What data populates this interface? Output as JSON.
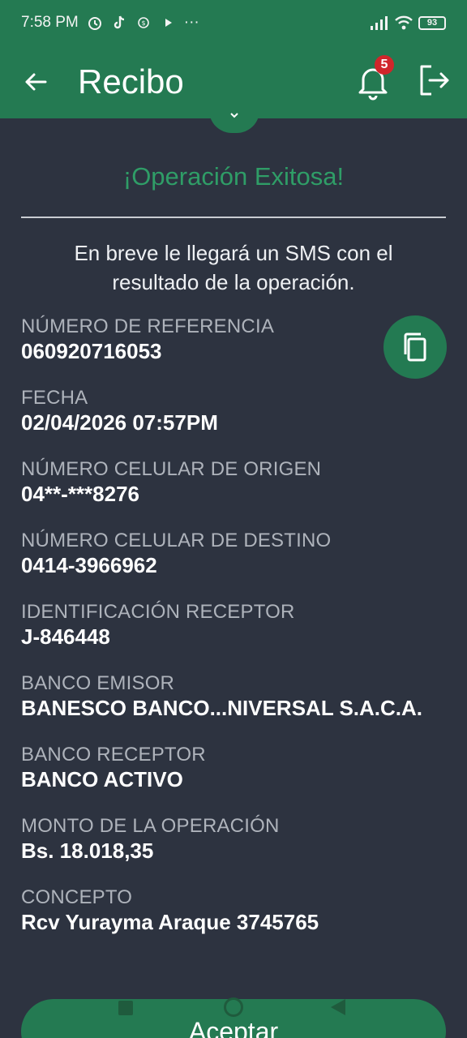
{
  "status_bar": {
    "time": "7:58 PM",
    "notification_icons": [
      "alarm-icon",
      "tiktok-icon",
      "app-icon",
      "play-icon"
    ],
    "more": "···",
    "battery": "93"
  },
  "app_bar": {
    "title": "Recibo",
    "notification_count": "5"
  },
  "receipt": {
    "status_title": "¡Operación Exitosa!",
    "sms_message": "En breve le llegará un SMS con el resultado de la operación.",
    "fields": [
      {
        "label": "NÚMERO DE REFERENCIA",
        "value": "060920716053"
      },
      {
        "label": "FECHA",
        "value": "02/04/2026 07:57PM"
      },
      {
        "label": "NÚMERO CELULAR DE ORIGEN",
        "value": "04**-***8276"
      },
      {
        "label": "NÚMERO CELULAR DE DESTINO",
        "value": "0414-3966962"
      },
      {
        "label": "IDENTIFICACIÓN RECEPTOR",
        "value": "J-846448"
      },
      {
        "label": "BANCO EMISOR",
        "value": "BANESCO BANCO...NIVERSAL S.A.C.A."
      },
      {
        "label": "BANCO RECEPTOR",
        "value": "BANCO ACTIVO"
      },
      {
        "label": "MONTO DE LA OPERACIÓN",
        "value": "Bs. 18.018,35"
      },
      {
        "label": "CONCEPTO",
        "value": "Rcv Yurayma Araque 3745765"
      }
    ]
  },
  "actions": {
    "accept_label": "Aceptar"
  },
  "colors": {
    "primary_green": "#247a52",
    "success_text": "#2f9d67",
    "background": "#2d3340",
    "badge_red": "#d0262b"
  }
}
